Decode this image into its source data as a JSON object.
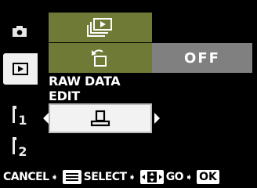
{
  "tabs": [
    {
      "name": "camera",
      "icon": "camera-icon"
    },
    {
      "name": "playback",
      "icon": "playback-icon",
      "selected": true
    },
    {
      "name": "setup-1",
      "label": "1"
    },
    {
      "name": "setup-2",
      "label": "2"
    }
  ],
  "menu": {
    "rows": [
      {
        "icon": "slideshow-icon"
      },
      {
        "icon": "rotate-icon"
      },
      {
        "label": "RAW DATA EDIT"
      },
      {
        "icon": "print-icon",
        "selected": true
      }
    ],
    "rotate_value": "OFF"
  },
  "guide": {
    "cancel": "CANCEL",
    "select": "SELECT",
    "go": "GO",
    "ok": "OK"
  },
  "colors": {
    "row_olive": "#6f7a37",
    "value_gray": "#808080",
    "selected_bg": "#f2f2f2"
  }
}
